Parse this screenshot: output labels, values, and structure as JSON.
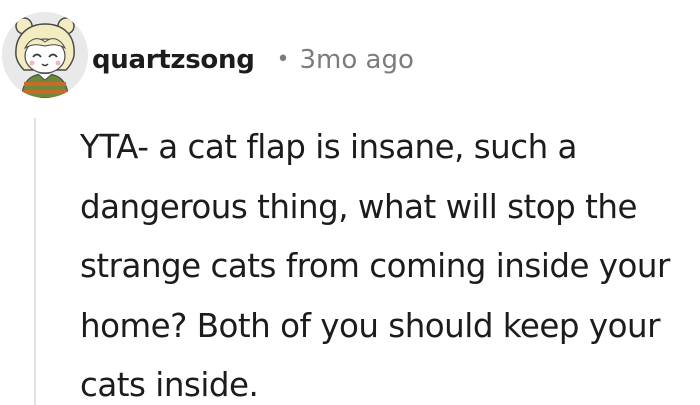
{
  "comment": {
    "username": "quartzsong",
    "separator": "•",
    "timestamp": "3mo ago",
    "body": "YTA- a cat flap is insane, such a dangerous thing, what will stop the strange cats from coming inside your home? Both of you should keep your cats inside."
  },
  "avatar": {
    "icon": "cartoon-avatar-icon",
    "background_color": "#e9e9e9"
  },
  "colors": {
    "text": "#1c1c1c",
    "meta": "#7c7c7c",
    "thread_line": "#e2e2e2"
  }
}
